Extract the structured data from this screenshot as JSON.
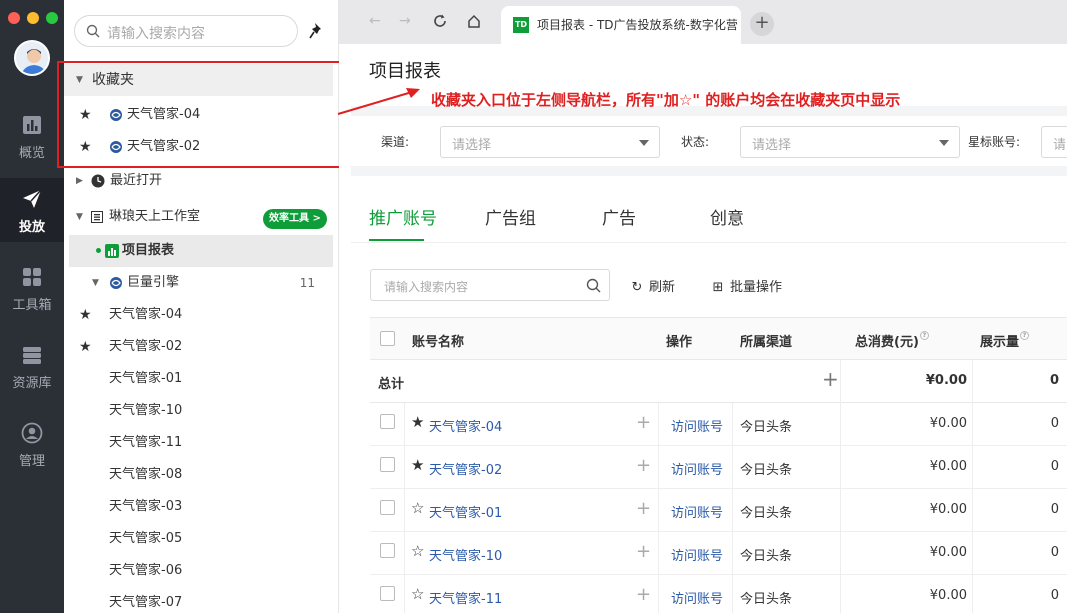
{
  "rail": {
    "items": [
      {
        "label": "概览"
      },
      {
        "label": "投放"
      },
      {
        "label": "工具箱"
      },
      {
        "label": "资源库"
      },
      {
        "label": "管理"
      }
    ]
  },
  "tree": {
    "search_placeholder": "请输入搜索内容",
    "favorites_label": "收藏夹",
    "favorites": [
      "天气管家-04",
      "天气管家-02"
    ],
    "recent_label": "最近打开",
    "workspace_label": "琳琅天上工作室",
    "efficiency_badge": "效率工具 >",
    "project_report_label": "项目报表",
    "engine_label": "巨量引擎",
    "engine_count": "11",
    "accounts": [
      "天气管家-04",
      "天气管家-02",
      "天气管家-01",
      "天气管家-10",
      "天气管家-11",
      "天气管家-08",
      "天气管家-03",
      "天气管家-05",
      "天气管家-06",
      "天气管家-07"
    ]
  },
  "browser": {
    "tab_title": "项目报表 - TD广告投放系统-数字化营",
    "tab_logo": "TD"
  },
  "page": {
    "title": "项目报表",
    "annotation": "收藏夹入口位于左侧导航栏，所有\"加☆\" 的账户均会在收藏夹页中显示",
    "filters": {
      "channel_label": "渠道:",
      "channel_placeholder": "请选择",
      "status_label": "状态:",
      "status_placeholder": "请选择",
      "star_label": "星标账号:",
      "star_placeholder": "请"
    },
    "subtabs": [
      "推广账号",
      "广告组",
      "广告",
      "创意"
    ],
    "table_search_placeholder": "请输入搜索内容",
    "refresh_label": "刷新",
    "batch_label": "批量操作",
    "headers": {
      "name": "账号名称",
      "action": "操作",
      "channel": "所属渠道",
      "cost": "总消费(元)",
      "impressions": "展示量"
    },
    "total": {
      "label": "总计",
      "cost": "¥0.00",
      "impressions": "0"
    },
    "rows": [
      {
        "star": "★",
        "name": "天气管家-04",
        "action": "访问账号",
        "channel": "今日头条",
        "cost": "¥0.00",
        "impressions": "0"
      },
      {
        "star": "★",
        "name": "天气管家-02",
        "action": "访问账号",
        "channel": "今日头条",
        "cost": "¥0.00",
        "impressions": "0"
      },
      {
        "star": "☆",
        "name": "天气管家-01",
        "action": "访问账号",
        "channel": "今日头条",
        "cost": "¥0.00",
        "impressions": "0"
      },
      {
        "star": "☆",
        "name": "天气管家-10",
        "action": "访问账号",
        "channel": "今日头条",
        "cost": "¥0.00",
        "impressions": "0"
      },
      {
        "star": "☆",
        "name": "天气管家-11",
        "action": "访问账号",
        "channel": "今日头条",
        "cost": "¥0.00",
        "impressions": "0"
      }
    ]
  },
  "colors": {
    "accent": "#0f9d3a",
    "annotation": "#e02020",
    "link": "#2b5aa8",
    "rail": "#2b2f36"
  }
}
